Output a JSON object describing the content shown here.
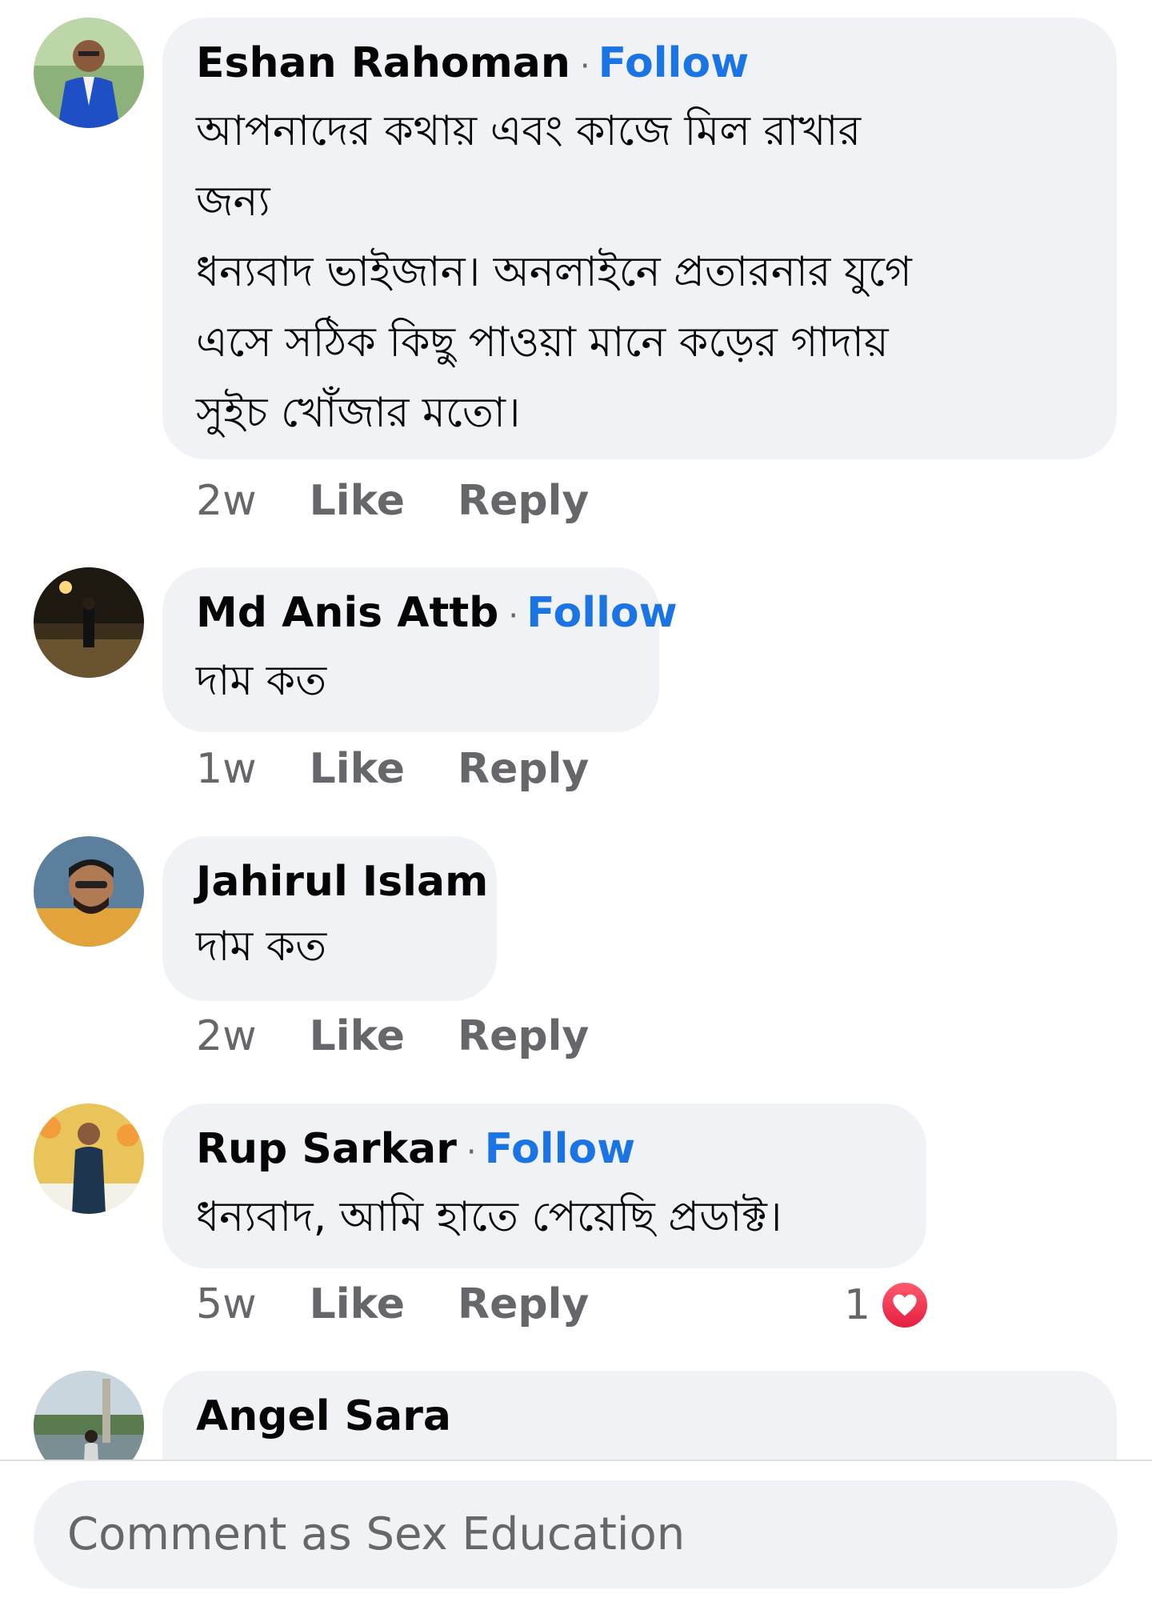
{
  "comments": [
    {
      "name": "Eshan Rahoman",
      "follow": "Follow",
      "text": "আপনাদের কথায় এবং কাজে মিল রাখার\nজন্য\nধন্যবাদ ভাইজান। অনলাইনে প্রতারনার যুগে\nএসে সঠিক কিছু পাওয়া মানে কড়ের গাদায়\nসুইচ খোঁজার মতো।",
      "time": "2w",
      "like": "Like",
      "reply": "Reply"
    },
    {
      "name": "Md Anis Attb",
      "follow": "Follow",
      "text": "দাম কত",
      "time": "1w",
      "like": "Like",
      "reply": "Reply"
    },
    {
      "name": "Jahirul Islam",
      "text": "দাম কত",
      "time": "2w",
      "like": "Like",
      "reply": "Reply"
    },
    {
      "name": "Rup Sarkar",
      "follow": "Follow",
      "text": "ধন্যবাদ,  আমি হাতে পেয়েছি প্রডাক্ট।",
      "time": "5w",
      "like": "Like",
      "reply": "Reply",
      "reaction_count": "1",
      "reaction_icon": "heart-icon"
    },
    {
      "name": "Angel Sara"
    }
  ],
  "composer": {
    "placeholder": "Comment as Sex Education"
  },
  "colors": {
    "bubble": "#f0f2f5",
    "follow": "#1b74e4",
    "meta": "#65676b",
    "heart": "#e41e3f"
  }
}
